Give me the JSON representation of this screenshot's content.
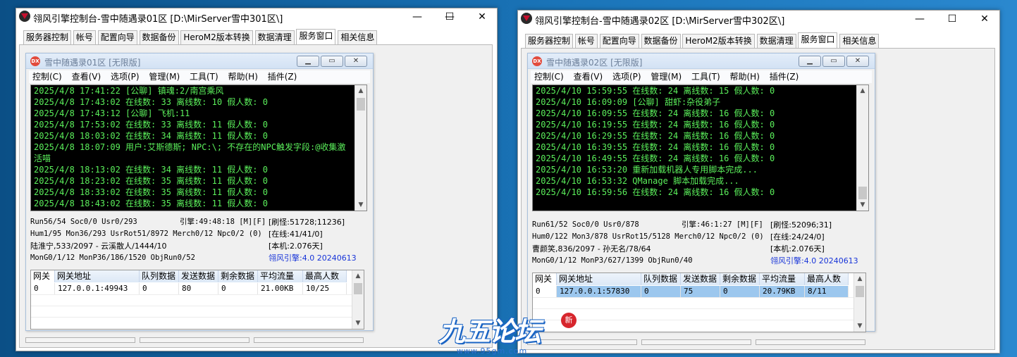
{
  "windows": [
    {
      "title": "翎风引擎控制台-雪中随遇录01区 [D:\\MirServer雪中301区\\]",
      "controls": {
        "minimize": "—",
        "maximize": "☐",
        "close": "✕"
      },
      "tabs": [
        "服务器控制",
        "帐号",
        "配置向导",
        "数据备份",
        "HeroM2版本转换",
        "数据清理",
        "服务窗口",
        "相关信息"
      ],
      "selected_tab": 6,
      "child": {
        "title": "雪中随遇录01区 [无限版]",
        "icon_text": "DX",
        "menu": [
          "控制(C)",
          "查看(V)",
          "选项(P)",
          "管理(M)",
          "工具(T)",
          "帮助(H)",
          "插件(Z)"
        ],
        "log": [
          "2025/4/8 17:41:22 [公聊] 镇魂:2/南宫乘风",
          "2025/4/8 17:43:02 在线数: 33 离线数: 10 假人数: 0",
          "2025/4/8 17:43:12 [公聊] 飞机:11",
          "2025/4/8 17:53:02 在线数: 33 离线数: 11 假人数: 0",
          "2025/4/8 18:03:02 在线数: 34 离线数: 11 假人数: 0",
          "2025/4/8 18:07:09 用户:艾斯德斯; NPC:\\; 不存在的NPC触发字段:@收集激活喵",
          "2025/4/8 18:13:02 在线数: 34 离线数: 11 假人数: 0",
          "2025/4/8 18:23:02 在线数: 35 离线数: 11 假人数: 0",
          "2025/4/8 18:33:02 在线数: 35 离线数: 11 假人数: 0",
          "2025/4/8 18:43:02 在线数: 35 离线数: 11 假人数: 0"
        ],
        "stats": {
          "r1c1": "Run56/54 Soc0/0 Usr0/293",
          "r1c2": "引擎:49:48:18 [M][F]",
          "r1c3": "[刷怪:51728;11236]",
          "r2c1": "Hum1/95 Mon36/293 UsrRot51/8972 Merch0/12 Npc0/2 (0)",
          "r2c3": "[在线:41/41/0]",
          "r3c1": "陆淮宁,533/2097 - 云溪散人/1444/10",
          "r3c3": "[本机:2.076天]",
          "r4c1": "MonG0/1/12 MonP36/186/1520 ObjRun0/52",
          "r4c3": "翎风引擎:4.0 20240613"
        },
        "table": {
          "headers": [
            "网关",
            "网关地址",
            "队列数据",
            "发送数据",
            "剩余数据",
            "平均流量",
            "最高人数"
          ],
          "rows": [
            [
              "0",
              "127.0.0.1:49943",
              "0",
              "80",
              "0",
              "21.00KB",
              "10/25"
            ]
          ]
        }
      }
    },
    {
      "title": "翎风引擎控制台-雪中随遇录02区 [D:\\MirServer雪中302区\\]",
      "controls": {
        "minimize": "—",
        "maximize": "☐",
        "close": "✕"
      },
      "tabs": [
        "服务器控制",
        "帐号",
        "配置向导",
        "数据备份",
        "HeroM2版本转换",
        "数据清理",
        "服务窗口",
        "相关信息"
      ],
      "selected_tab": 6,
      "child": {
        "title": "雪中随遇录02区 [无限版]",
        "icon_text": "DX",
        "menu": [
          "控制(C)",
          "查看(V)",
          "选项(P)",
          "管理(M)",
          "工具(T)",
          "帮助(H)",
          "插件(Z)"
        ],
        "log": [
          "2025/4/10 15:59:55 在线数: 24 离线数: 15 假人数: 0",
          "2025/4/10 16:09:09 [公聊] 甜虾:杂役弟子",
          "2025/4/10 16:09:55 在线数: 24 离线数: 16 假人数: 0",
          "2025/4/10 16:19:55 在线数: 24 离线数: 16 假人数: 0",
          "2025/4/10 16:29:55 在线数: 24 离线数: 16 假人数: 0",
          "2025/4/10 16:39:55 在线数: 24 离线数: 16 假人数: 0",
          "2025/4/10 16:49:55 在线数: 24 离线数: 16 假人数: 0",
          "2025/4/10 16:53:20 重新加载机器人专用脚本完成...",
          "2025/4/10 16:53:32 QManage 脚本加载完成...",
          "2025/4/10 16:59:56 在线数: 24 离线数: 16 假人数: 0"
        ],
        "stats": {
          "r1c1": "Run61/52 Soc0/0 Usr0/878",
          "r1c2": "引擎:46:1:27 [M][F]",
          "r1c3": "[刷怪:52096;31]",
          "r2c1": "Hum0/122 Mon3/878 UsrRot15/5128 Merch0/12 Npc0/2 (0)",
          "r2c3": "[在线:24/24/0]",
          "r3c1": "曹颜笑,836/2097 - 孙无名/78/64",
          "r3c3": "[本机:2.076天]",
          "r4c1": "MonG0/1/12 MonP3/627/1399 ObjRun0/40",
          "r4c3": "翎风引擎:4.0 20240613"
        },
        "table": {
          "headers": [
            "网关",
            "网关地址",
            "队列数据",
            "发送数据",
            "剩余数据",
            "平均流量",
            "最高人数"
          ],
          "rows": [
            [
              "0",
              "127.0.0.1:57830",
              "0",
              "75",
              "0",
              "20.79KB",
              "8/11"
            ]
          ]
        }
      }
    }
  ],
  "watermark": {
    "logo_text": "九五论坛",
    "url": "www.95gm.com",
    "seal": "新"
  },
  "colors": {
    "log_text": "#5bf05b",
    "log_bg": "#000000",
    "engine_version": "#1734d8",
    "row_highlight": "#9cc7ee"
  }
}
